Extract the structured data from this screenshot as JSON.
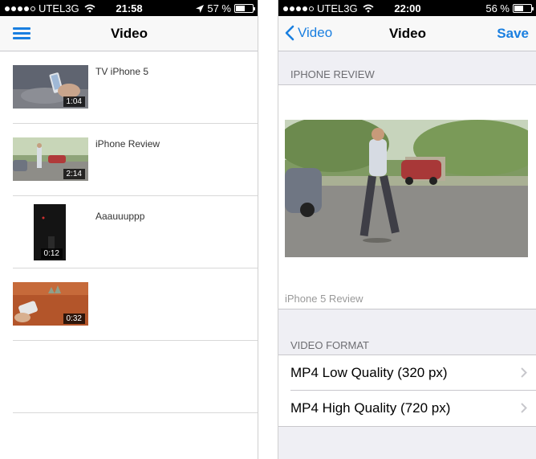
{
  "left": {
    "status": {
      "carrier": "UTEL3G",
      "time": "21:58",
      "battery": "57 %",
      "battery_level": 0.57
    },
    "nav": {
      "title": "Video"
    },
    "videos": [
      {
        "title": "TV iPhone 5",
        "duration": "1:04"
      },
      {
        "title": "iPhone Review",
        "duration": "2:14"
      },
      {
        "title": "Aaauuuppp",
        "duration": "0:12"
      },
      {
        "title": "",
        "duration": "0:32"
      }
    ]
  },
  "right": {
    "status": {
      "carrier": "UTEL3G",
      "time": "22:00",
      "battery": "56 %",
      "battery_level": 0.56
    },
    "nav": {
      "back_label": "Video",
      "title": "Video",
      "save_label": "Save"
    },
    "preview_section": {
      "header": "IPHONE REVIEW",
      "caption": "iPhone 5 Review"
    },
    "format_section": {
      "header": "VIDEO FORMAT",
      "options": [
        {
          "label": "MP4 Low Quality (320 px)"
        },
        {
          "label": "MP4 High Quality (720 px)"
        }
      ]
    }
  },
  "colors": {
    "accent": "#1a7fe0",
    "separator": "#c8c7cc",
    "group_bg": "#efeff4"
  },
  "icons": [
    "menu-icon",
    "wifi-icon",
    "location-arrow-icon",
    "battery-icon",
    "back-chevron-icon",
    "chevron-right-icon"
  ]
}
